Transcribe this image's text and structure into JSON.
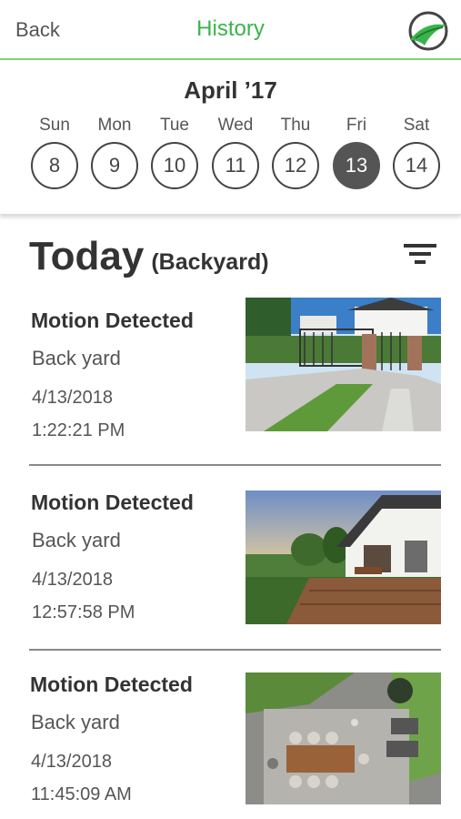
{
  "header": {
    "back_label": "Back",
    "title": "History",
    "accent_color": "#3ab44a",
    "logo_icon": "leaf-swoosh-logo"
  },
  "calendar": {
    "month_label": "April ’17",
    "days": [
      {
        "name": "Sun",
        "number": "8",
        "selected": false
      },
      {
        "name": "Mon",
        "number": "9",
        "selected": false
      },
      {
        "name": "Tue",
        "number": "10",
        "selected": false
      },
      {
        "name": "Wed",
        "number": "11",
        "selected": false
      },
      {
        "name": "Thu",
        "number": "12",
        "selected": false
      },
      {
        "name": "Fri",
        "number": "13",
        "selected": true
      },
      {
        "name": "Sat",
        "number": "14",
        "selected": false
      }
    ]
  },
  "section": {
    "heading": "Today",
    "location": "(Backyard)",
    "filter_icon": "filter-icon"
  },
  "events": [
    {
      "title": "Motion Detected",
      "location": "Back yard",
      "date": "4/13/2018",
      "time": "1:22:21 PM"
    },
    {
      "title": "Motion Detected",
      "location": "Back yard",
      "date": "4/13/2018",
      "time": "12:57:58 PM"
    },
    {
      "title": "Motion Detected",
      "location": "Back yard",
      "date": "4/13/2018",
      "time": "11:45:09 AM"
    }
  ]
}
